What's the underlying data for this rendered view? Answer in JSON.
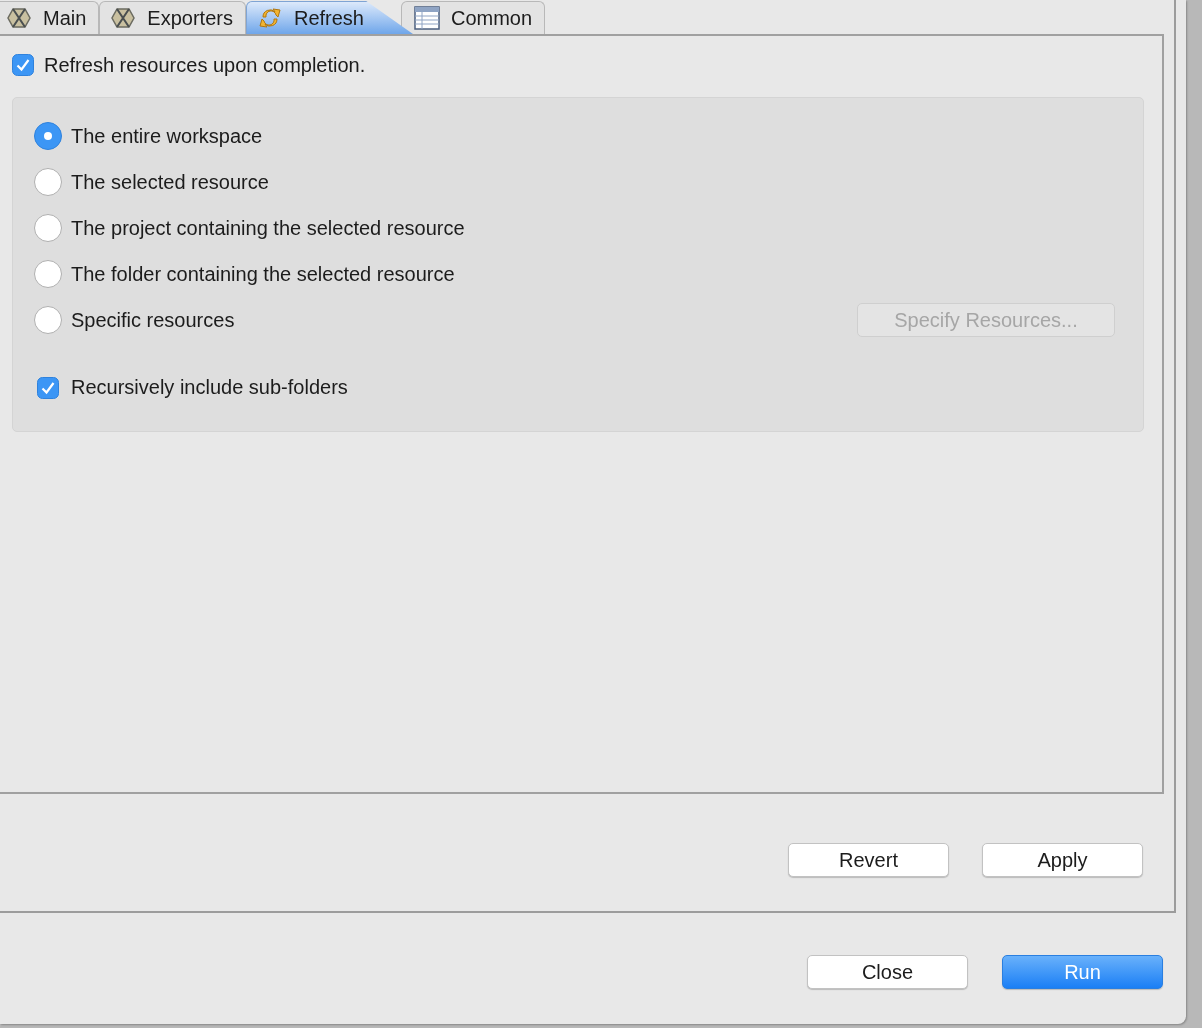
{
  "tabs": [
    {
      "label": "Main",
      "selected": false,
      "kind": "gem"
    },
    {
      "label": "Exporters",
      "selected": false,
      "kind": "gem"
    },
    {
      "label": "Refresh",
      "selected": true,
      "kind": "refresh"
    },
    {
      "label": "Common",
      "selected": false,
      "kind": "table"
    }
  ],
  "refresh_option": {
    "label": "Refresh resources upon completion.",
    "checked": true
  },
  "scope_options": [
    {
      "label": "The entire workspace",
      "selected": true
    },
    {
      "label": "The selected resource",
      "selected": false
    },
    {
      "label": "The project containing the selected resource",
      "selected": false
    },
    {
      "label": "The folder containing the selected resource",
      "selected": false
    },
    {
      "label": "Specific resources",
      "selected": false
    }
  ],
  "specify_button": {
    "label": "Specify Resources...",
    "disabled": true
  },
  "recursive_option": {
    "label": "Recursively include sub-folders",
    "checked": true
  },
  "tab_buttons": [
    {
      "label": "Revert",
      "primary": false
    },
    {
      "label": "Apply",
      "primary": false
    }
  ],
  "dialog_buttons": [
    {
      "label": "Close",
      "primary": false
    },
    {
      "label": "Run",
      "primary": true
    }
  ]
}
